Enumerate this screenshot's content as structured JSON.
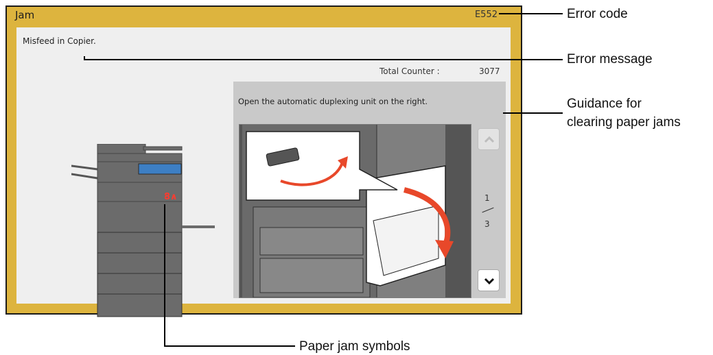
{
  "screen": {
    "title": "Jam",
    "error_code": "E552",
    "message": "Misfeed in Copier.",
    "counter_label": "Total Counter :",
    "counter_value": "3077",
    "guidance_text": "Open the automatic duplexing unit on the right.",
    "page_current": "1",
    "page_total": "3",
    "page_up_icon": "chevron-up-icon",
    "page_down_icon": "chevron-down-icon",
    "jam_symbol": "8∧"
  },
  "annotations": {
    "error_code": "Error code",
    "error_message": "Error message",
    "guidance_line1": "Guidance for",
    "guidance_line2": "clearing paper jams",
    "jam_symbols": "Paper jam symbols"
  },
  "colors": {
    "frame": "#ddb43e",
    "panel": "#efefef",
    "guidance_panel": "#c9c9c9",
    "arrow": "#e8482a"
  }
}
